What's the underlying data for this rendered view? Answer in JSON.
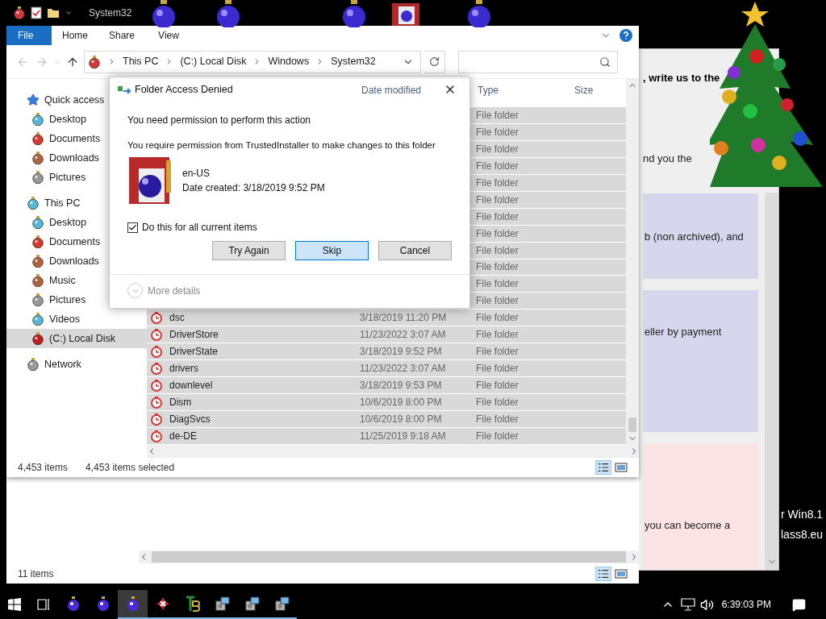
{
  "explorer": {
    "title": "System32",
    "ribbon_tabs": [
      {
        "label": "File",
        "selected": true
      },
      {
        "label": "Home",
        "selected": false
      },
      {
        "label": "Share",
        "selected": false
      },
      {
        "label": "View",
        "selected": false
      }
    ],
    "breadcrumb": [
      "This PC",
      "(C:) Local Disk",
      "Windows",
      "System32"
    ],
    "sidebar": [
      {
        "label": "Quick access",
        "kind": "star",
        "selected": false,
        "children": [
          {
            "label": "Desktop",
            "kind": "blue",
            "selected": false
          },
          {
            "label": "Documents",
            "kind": "red",
            "selected": false
          },
          {
            "label": "Downloads",
            "kind": "brown",
            "selected": false
          },
          {
            "label": "Pictures",
            "kind": "grey",
            "selected": false
          }
        ]
      },
      {
        "label": "This PC",
        "kind": "blue",
        "selected": false,
        "children": [
          {
            "label": "Desktop",
            "kind": "blue",
            "selected": false
          },
          {
            "label": "Documents",
            "kind": "red",
            "selected": false
          },
          {
            "label": "Downloads",
            "kind": "brown",
            "selected": false
          },
          {
            "label": "Music",
            "kind": "brown",
            "selected": false
          },
          {
            "label": "Pictures",
            "kind": "grey",
            "selected": false
          },
          {
            "label": "Videos",
            "kind": "blue",
            "selected": false
          },
          {
            "label": "(C:) Local Disk",
            "kind": "disk",
            "selected": true
          }
        ]
      },
      {
        "label": "Network",
        "kind": "grey",
        "selected": false
      }
    ],
    "columns": [
      "Date modified",
      "Type",
      "Size"
    ],
    "rows": [
      {
        "type": "File folder",
        "selected": true
      },
      {
        "type": "File folder",
        "selected": true
      },
      {
        "type": "File folder",
        "selected": true
      },
      {
        "type": "File folder",
        "selected": true
      },
      {
        "type": "File folder",
        "selected": true
      },
      {
        "type": "File folder",
        "selected": true
      },
      {
        "type": "File folder",
        "selected": true
      },
      {
        "type": "File folder",
        "selected": true
      },
      {
        "type": "File folder",
        "selected": true
      },
      {
        "type": "File folder",
        "selected": true
      },
      {
        "type": "File folder",
        "selected": true
      },
      {
        "type": "File folder",
        "selected": true
      },
      {
        "name": "dsc",
        "date": "3/18/2019 11:20 PM",
        "type": "File folder",
        "selected": true
      },
      {
        "name": "DriverStore",
        "date": "11/23/2022 3:07 AM",
        "type": "File folder",
        "selected": true
      },
      {
        "name": "DriverState",
        "date": "3/18/2019 9:52 PM",
        "type": "File folder",
        "selected": true
      },
      {
        "name": "drivers",
        "date": "11/23/2022 3:07 AM",
        "type": "File folder",
        "selected": true
      },
      {
        "name": "downlevel",
        "date": "3/18/2019 9:53 PM",
        "type": "File folder",
        "selected": true
      },
      {
        "name": "Dism",
        "date": "10/6/2019 8:00 PM",
        "type": "File folder",
        "selected": true
      },
      {
        "name": "DiagSvcs",
        "date": "10/6/2019 8:00 PM",
        "type": "File folder",
        "selected": true
      },
      {
        "name": "de-DE",
        "date": "11/25/2019 9:18 AM",
        "type": "File folder",
        "selected": true
      }
    ],
    "status": {
      "count": "4,453 items",
      "selection": "4,453 items selected"
    }
  },
  "dialog": {
    "title": "Folder Access Denied",
    "message": "You need permission to perform this action",
    "detail": "You require permission from TrustedInstaller to make changes to this folder",
    "item": {
      "name": "en-US",
      "date": "Date created: 3/18/2019 9:52 PM"
    },
    "checkbox": {
      "label": "Do this for all current items",
      "checked": true
    },
    "buttons": [
      {
        "label": "Try Again",
        "focused": false
      },
      {
        "label": "Skip",
        "focused": true
      },
      {
        "label": "Cancel",
        "focused": false
      }
    ],
    "more_details": "More details"
  },
  "back_explorer": {
    "status": "11 items"
  },
  "web_page": {
    "items": [
      {
        "kind": "heading",
        "text": ", write us to the"
      },
      {
        "kind": "text",
        "text": "nd you the"
      },
      {
        "kind": "panel",
        "color": "#d6d6ec",
        "text": "b (non archived), and"
      },
      {
        "kind": "panel",
        "color": "#d6d6ec",
        "text": "eller by payment"
      },
      {
        "kind": "panel",
        "color": "#fbe3e3",
        "text": "you can become a"
      }
    ]
  },
  "desktop_texts": [
    "r Win8.1",
    "lass8.eu"
  ],
  "taskbar": {
    "apps": [
      {
        "kind": "ornament",
        "running": false,
        "active": false
      },
      {
        "kind": "ornament",
        "running": false,
        "active": false
      },
      {
        "kind": "ornament",
        "running": true,
        "active": true
      },
      {
        "kind": "cross",
        "running": true,
        "active": false
      },
      {
        "kind": "logo",
        "running": true,
        "active": false
      },
      {
        "kind": "setup",
        "running": true,
        "active": false
      },
      {
        "kind": "setup",
        "running": true,
        "active": false
      },
      {
        "kind": "setup",
        "running": true,
        "active": false
      }
    ],
    "time": "6:39:03 PM"
  }
}
